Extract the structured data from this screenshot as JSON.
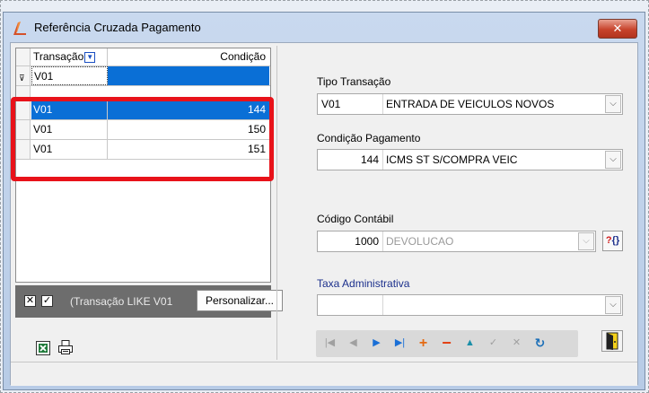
{
  "window": {
    "title": "Referência Cruzada Pagamento",
    "close_label": "✕"
  },
  "grid": {
    "headers": [
      "Transação",
      "Condição"
    ],
    "filter_row": {
      "transacao": "V01",
      "condicao": ""
    },
    "rows": [
      {
        "transacao": "V01",
        "condicao": "144",
        "selected": true
      },
      {
        "transacao": "V01",
        "condicao": "150",
        "selected": false
      },
      {
        "transacao": "V01",
        "condicao": "151",
        "selected": false
      }
    ]
  },
  "filter_bar": {
    "text": "(Transação LIKE V01",
    "customize_label": "Personalizar..."
  },
  "form": {
    "tipo_transacao": {
      "label": "Tipo Transação",
      "code": "V01",
      "desc": "ENTRADA DE VEICULOS NOVOS"
    },
    "condicao_pagamento": {
      "label": "Condição Pagamento",
      "code": "144",
      "desc": "ICMS ST S/COMPRA VEIC"
    },
    "codigo_contabil": {
      "label": "Código Contábil",
      "code": "1000",
      "desc": "DEVOLUCAO",
      "help": "?{}"
    },
    "taxa_administrativa": {
      "label": "Taxa Administrativa",
      "code": "",
      "desc": ""
    }
  },
  "colors": {
    "selection": "#0a6fd6",
    "highlight_box": "#e8121a",
    "link_label": "#1b2f8c"
  }
}
